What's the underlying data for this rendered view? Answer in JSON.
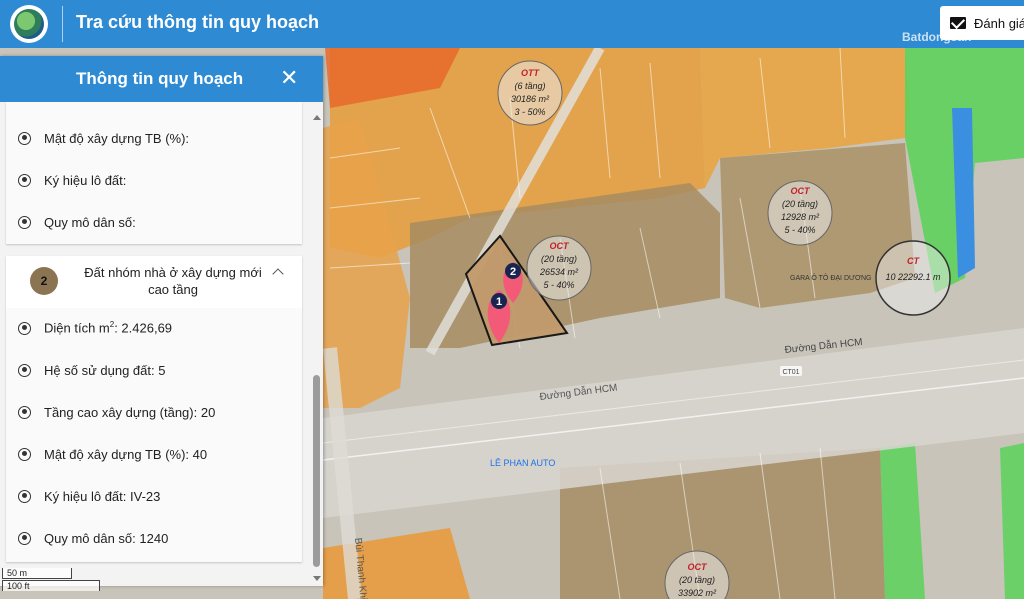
{
  "header": {
    "title": "Tra cứu thông tin quy hoạch",
    "rate_label": "Đánh giá"
  },
  "watermark": "Batdongsan",
  "panel": {
    "title": "Thông tin quy hoạch",
    "close": "✕",
    "card1_rows": [
      "Mật độ xây dựng TB (%):",
      "Ký hiệu lô đất:",
      "Quy mô dân số:"
    ],
    "lot": {
      "number": "2",
      "name": "Đất nhóm nhà ở xây dựng mới cao tầng",
      "area_label": "Diện tích m",
      "area_sup": "2",
      "area_value": ": 2.426,69",
      "rows": [
        "Hệ số sử dụng đất: 5",
        "Tầng cao xây dựng (tầng): 20",
        "Mật độ xây dựng TB (%): 40",
        "Ký hiệu lô đất: IV-23",
        "Quy mô dân số: 1240"
      ]
    }
  },
  "scale": {
    "metric": "50 m",
    "imperial": "100 ft"
  },
  "map": {
    "road_labels": [
      "Đường Dẫn HCM",
      "Đường Dẫn HCM",
      "Bùi Thanh Khiết"
    ],
    "road_code": "CT01",
    "poi": [
      "LÊ PHAN AUTO",
      "GARA Ô TÔ ĐẠI DƯƠNG"
    ],
    "markers": [
      "1",
      "2"
    ],
    "zones": [
      {
        "code": "OTT",
        "l1": "(6 tầng)",
        "l2": "30186 m²",
        "l3": "3 - 50%"
      },
      {
        "code": "OCT",
        "l1": "(20 tầng)",
        "l2": "26534 m²",
        "l3": "5 - 40%"
      },
      {
        "code": "OCT",
        "l1": "(20 tầng)",
        "l2": "12928 m²",
        "l3": "5 - 40%"
      },
      {
        "code": "CT",
        "l1": "10 22292.1 m",
        "l2": "",
        "l3": ""
      },
      {
        "code": "OCT",
        "l1": "(20 tầng)",
        "l2": "33902 m²",
        "l3": ""
      }
    ],
    "colors": {
      "orange": "#e8a23c",
      "brown": "#a68b5b",
      "green": "#68d166",
      "blue": "#3c8fe0",
      "lot": "#c79a6a",
      "marker": "#f25a78"
    }
  }
}
